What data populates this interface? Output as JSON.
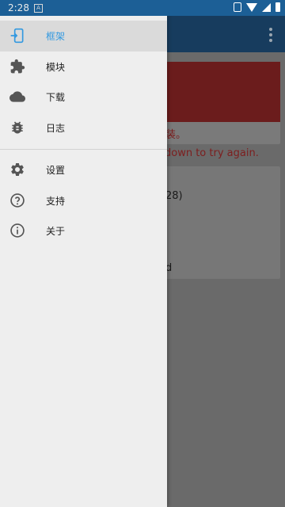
{
  "status_bar": {
    "time": "2:28",
    "notification_glyph": "A",
    "icons": [
      "vibrate-icon",
      "wifi-icon",
      "signal-icon",
      "battery-icon"
    ]
  },
  "background_app": {
    "card_warning_suffix": "装。",
    "pull_hint": "down to try again.",
    "info_line_1": "28)",
    "info_line_2": "d"
  },
  "drawer": {
    "primary": [
      {
        "id": "framework",
        "label": "框架",
        "icon": "framework-icon",
        "active": true
      },
      {
        "id": "modules",
        "label": "模块",
        "icon": "puzzle-icon",
        "active": false
      },
      {
        "id": "download",
        "label": "下载",
        "icon": "cloud-icon",
        "active": false
      },
      {
        "id": "logs",
        "label": "日志",
        "icon": "bug-icon",
        "active": false
      }
    ],
    "secondary": [
      {
        "id": "settings",
        "label": "设置",
        "icon": "gear-icon"
      },
      {
        "id": "support",
        "label": "支持",
        "icon": "help-circle-icon"
      },
      {
        "id": "about",
        "label": "关于",
        "icon": "info-circle-icon"
      }
    ]
  },
  "colors": {
    "accent": "#3399e0",
    "drawer_bg": "#eeeeee",
    "active_bg": "#dadada",
    "icon": "#555555"
  }
}
